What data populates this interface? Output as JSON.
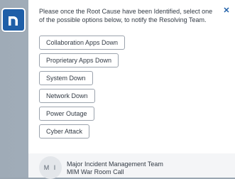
{
  "logo": {
    "letter": "n",
    "icon": "brand-logo-icon",
    "color": "#1f5fa8"
  },
  "message": "Please once the Root Cause have been Identified, select one of the possible options below, to notify the Resolving Team.",
  "close": {
    "icon": "close-icon",
    "glyph": "✕"
  },
  "options": [
    "Collaboration Apps Down",
    "Proprietary Apps Down",
    "System Down",
    "Network Down",
    "Power Outage",
    "Cyber Attack"
  ],
  "contact": {
    "initials": "M I",
    "line1": "Major Incident Management Team",
    "line2": "MIM War Room Call"
  }
}
